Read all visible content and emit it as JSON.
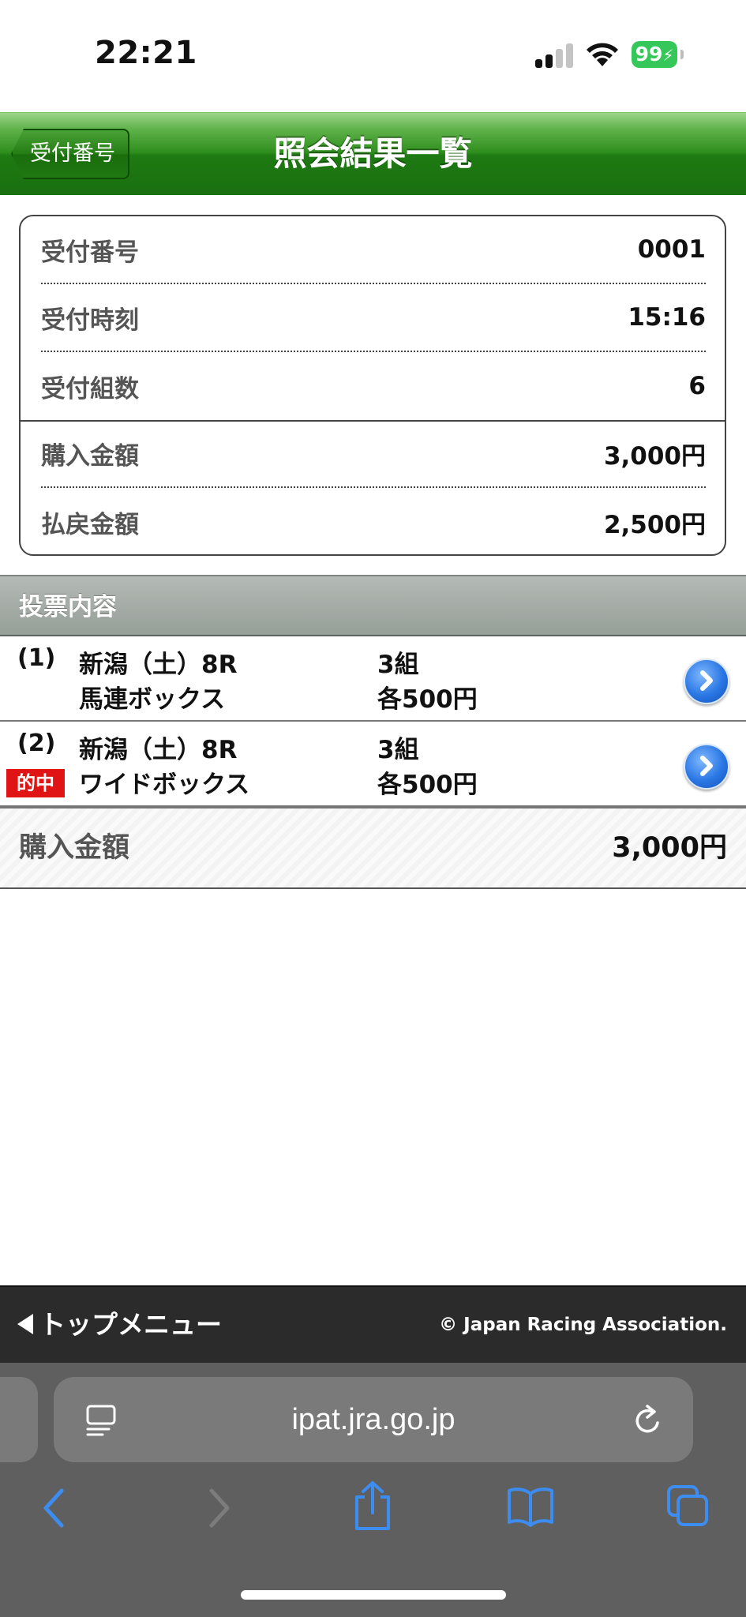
{
  "status_bar": {
    "time": "22:21",
    "battery": "99"
  },
  "header": {
    "back_label": "受付番号",
    "title": "照会結果一覧"
  },
  "info": {
    "rows": [
      {
        "label": "受付番号",
        "value": "0001"
      },
      {
        "label": "受付時刻",
        "value": "15:16"
      },
      {
        "label": "受付組数",
        "value": "6"
      },
      {
        "label": "購入金額",
        "value": "3,000円"
      },
      {
        "label": "払戻金額",
        "value": "2,500円"
      }
    ]
  },
  "section": {
    "title": "投票内容"
  },
  "bets": [
    {
      "no": "(1)",
      "race": "新潟（土）8R",
      "type": "馬連ボックス",
      "count": "3組",
      "amount": "各500円",
      "hit": ""
    },
    {
      "no": "(2)",
      "race": "新潟（土）8R",
      "type": "ワイドボックス",
      "count": "3組",
      "amount": "各500円",
      "hit": "的中"
    }
  ],
  "total": {
    "label": "購入金額",
    "value": "3,000円"
  },
  "footer": {
    "top_menu": "トップメニュー",
    "copyright": "© Japan Racing Association."
  },
  "browser": {
    "url": "ipat.jra.go.jp"
  },
  "colors": {
    "header_green": "#1e7a12",
    "hit_red": "#e01414",
    "arrow_blue": "#2a77e4",
    "toolbar_blue": "#3d8cf0"
  },
  "icons": [
    "signal-icon",
    "wifi-icon",
    "battery-icon",
    "chevron-right-icon",
    "back-triangle-icon",
    "tab-overview-icon",
    "reload-icon",
    "back-arrow-icon",
    "forward-arrow-icon",
    "share-icon",
    "bookmarks-icon",
    "tabs-icon"
  ]
}
